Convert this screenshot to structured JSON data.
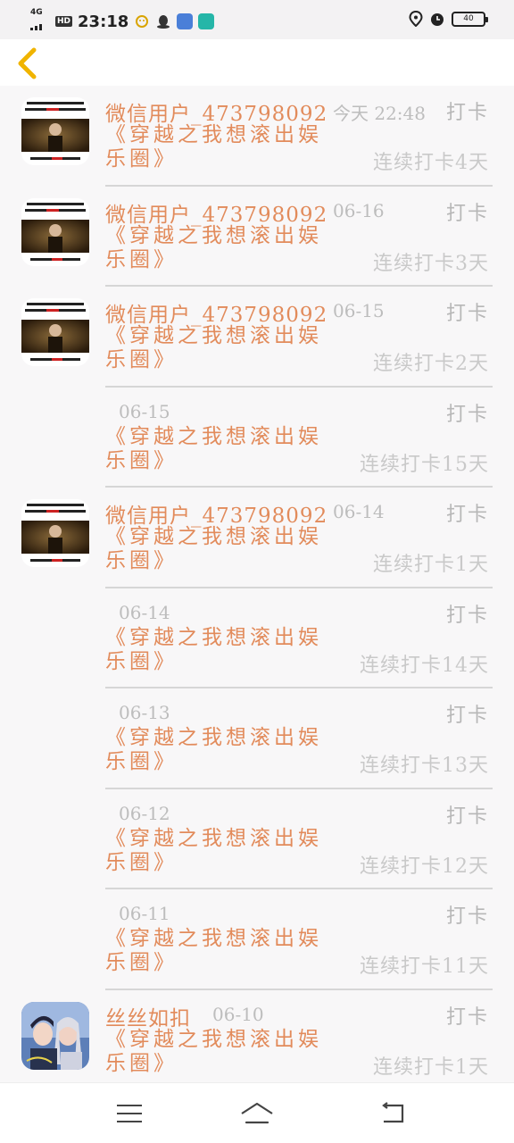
{
  "status_bar": {
    "network": "4G",
    "hd": "HD",
    "time": "23:18",
    "battery": "40",
    "icons": [
      "signal-icon",
      "wechat-icon",
      "qq-icon",
      "browser-icon",
      "app-icon",
      "location-icon",
      "alarm-icon",
      "battery-icon"
    ]
  },
  "header": {
    "back_icon": "chevron-left-icon",
    "accent": "#f0b400"
  },
  "colors": {
    "accent_text": "#e28b5b",
    "muted_text": "#bdbdbd"
  },
  "entries": [
    {
      "avatar": "edison",
      "username": "微信用户_473798092",
      "date": "今天 22:48",
      "checkin": "打卡",
      "book": "《穿越之我想滚出娱乐圈》",
      "streak": "连续打卡4天"
    },
    {
      "avatar": "edison",
      "username": "微信用户_473798092",
      "date": "06-16",
      "checkin": "打卡",
      "book": "《穿越之我想滚出娱乐圈》",
      "streak": "连续打卡3天"
    },
    {
      "avatar": "edison",
      "username": "微信用户_473798092",
      "date": "06-15",
      "checkin": "打卡",
      "book": "《穿越之我想滚出娱乐圈》",
      "streak": "连续打卡2天"
    },
    {
      "avatar": "",
      "username": "",
      "date": "06-15",
      "checkin": "打卡",
      "book": "《穿越之我想滚出娱乐圈》",
      "streak": "连续打卡15天"
    },
    {
      "avatar": "edison",
      "username": "微信用户_473798092",
      "date": "06-14",
      "checkin": "打卡",
      "book": "《穿越之我想滚出娱乐圈》",
      "streak": "连续打卡1天"
    },
    {
      "avatar": "",
      "username": "",
      "date": "06-14",
      "checkin": "打卡",
      "book": "《穿越之我想滚出娱乐圈》",
      "streak": "连续打卡14天"
    },
    {
      "avatar": "",
      "username": "",
      "date": "06-13",
      "checkin": "打卡",
      "book": "《穿越之我想滚出娱乐圈》",
      "streak": "连续打卡13天"
    },
    {
      "avatar": "",
      "username": "",
      "date": "06-12",
      "checkin": "打卡",
      "book": "《穿越之我想滚出娱乐圈》",
      "streak": "连续打卡12天"
    },
    {
      "avatar": "",
      "username": "",
      "date": "06-11",
      "checkin": "打卡",
      "book": "《穿越之我想滚出娱乐圈》",
      "streak": "连续打卡11天"
    },
    {
      "avatar": "anime",
      "username": "丝丝如扣",
      "date": "06-10",
      "checkin": "打卡",
      "book": "《穿越之我想滚出娱乐圈》",
      "streak": "连续打卡1天"
    }
  ],
  "nav": {
    "menu_icon": "menu-icon",
    "home_icon": "home-icon",
    "back_icon": "back-icon"
  }
}
